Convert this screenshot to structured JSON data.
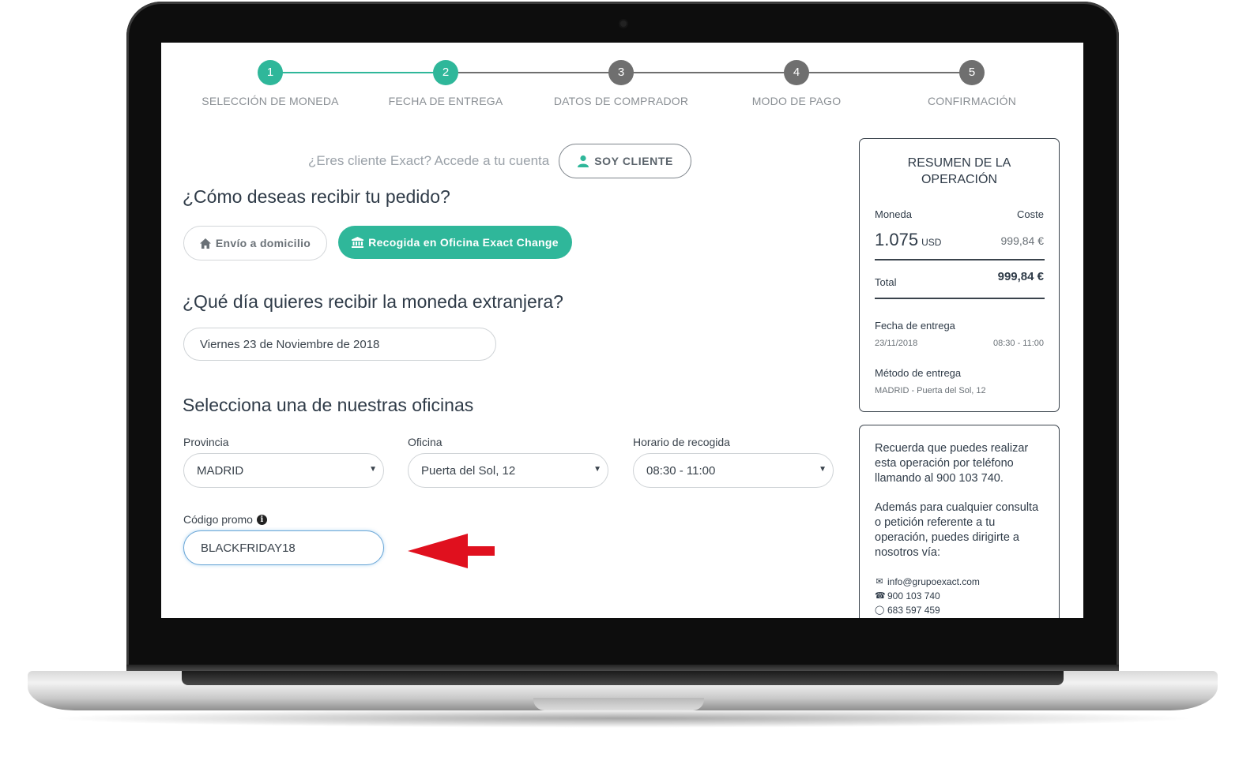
{
  "steps": [
    {
      "num": "1",
      "label": "SELECCIÓN DE MONEDA",
      "done": true
    },
    {
      "num": "2",
      "label": "FECHA DE ENTREGA",
      "done": true
    },
    {
      "num": "3",
      "label": "DATOS DE COMPRADOR",
      "done": false
    },
    {
      "num": "4",
      "label": "MODO DE PAGO",
      "done": false
    },
    {
      "num": "5",
      "label": "CONFIRMACIÓN",
      "done": false
    }
  ],
  "client": {
    "question": "¿Eres cliente Exact? Accede a tu cuenta",
    "button": "SOY CLIENTE"
  },
  "delivery": {
    "heading": "¿Cómo deseas recibir tu pedido?",
    "home_label": "Envío a domicilio",
    "pickup_label": "Recogida en Oficina Exact Change"
  },
  "date": {
    "heading": "¿Qué día quieres recibir la moneda extranjera?",
    "value": "Viernes 23 de Noviembre de 2018"
  },
  "offices": {
    "heading": "Selecciona una de nuestras oficinas",
    "province_label": "Provincia",
    "province_value": "MADRID",
    "office_label": "Oficina",
    "office_value": "Puerta del Sol, 12",
    "schedule_label": "Horario de recogida",
    "schedule_value": "08:30 - 11:00"
  },
  "promo": {
    "label": "Código promo",
    "value": "BLACKFRIDAY18"
  },
  "summary": {
    "title_line1": "RESUMEN DE LA",
    "title_line2": "OPERACIÓN",
    "col_currency": "Moneda",
    "col_cost": "Coste",
    "amount": "1.075",
    "currency": "USD",
    "cost": "999,84 €",
    "total_label": "Total",
    "total_value": "999,84 €",
    "delivery_date_label": "Fecha de entrega",
    "delivery_date": "23/11/2018",
    "delivery_time": "08:30 - 11:00",
    "method_label": "Método de entrega",
    "method_value": "MADRID - Puerta del Sol, 12"
  },
  "info": {
    "p1": "Recuerda que puedes realizar esta operación por teléfono llamando al 900 103 740.",
    "p2": "Además para cualquier consulta o petición referente a tu operación, puedes dirigirte a nosotros vía:",
    "email": "info@grupoexact.com",
    "phone": "900 103 740",
    "whatsapp": "683 597 459"
  },
  "colors": {
    "accent": "#2fb79a",
    "inactive": "#6f6f6f",
    "arrow": "#e0101e"
  }
}
